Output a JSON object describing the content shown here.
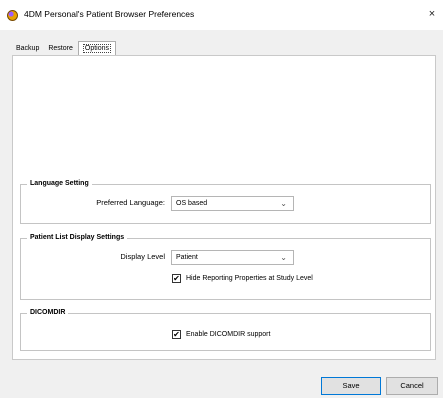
{
  "window": {
    "title": "4DM Personal's Patient Browser Preferences",
    "close_glyph": "×"
  },
  "tabs": [
    {
      "label": "Backup",
      "active": false
    },
    {
      "label": "Restore",
      "active": false
    },
    {
      "label": "Options",
      "active": true
    }
  ],
  "language_setting": {
    "group_title": "Language Setting",
    "preferred_language_label": "Preferred Language:",
    "preferred_language_value": "OS based"
  },
  "patient_list": {
    "group_title": "Patient List Display Settings",
    "display_level_label": "Display Level",
    "display_level_value": "Patient",
    "hide_reporting_label": "Hide Reporting Properties at Study Level",
    "hide_reporting_checked": true
  },
  "dicomdir": {
    "group_title": "DICOMDIR",
    "enable_label": "Enable DICOMDIR support",
    "enable_checked": true
  },
  "footer": {
    "save_label": "Save",
    "cancel_label": "Cancel"
  },
  "icons": {
    "check_glyph": "✔",
    "chevron_glyph": "⌄"
  }
}
